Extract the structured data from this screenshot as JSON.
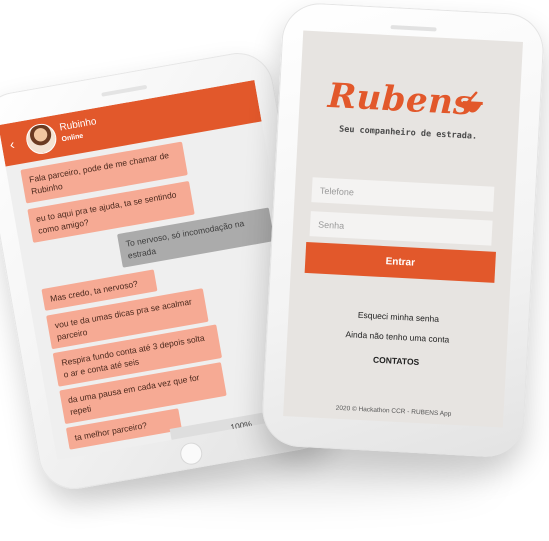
{
  "chat": {
    "contact_name": "Rubinho",
    "status": "Online",
    "back_icon": "back-arrow-icon",
    "messages": [
      {
        "from": "bot",
        "text": "Fala parceiro, pode de me chamar de Rubinho"
      },
      {
        "from": "bot",
        "text": "eu to aqui pra te ajuda, ta se sentindo como amigo?"
      },
      {
        "from": "user",
        "text": "To nervoso, só incomodação na estrada"
      },
      {
        "from": "bot",
        "text": "Mas credo, ta nervoso?"
      },
      {
        "from": "bot",
        "text": "vou te da umas dicas pra se acalmar parceiro"
      },
      {
        "from": "bot",
        "text": "Respira fundo conta até 3 depois solta o ar e conta até seis"
      },
      {
        "from": "bot",
        "text": "da uma pausa em cada vez que for repeti"
      },
      {
        "from": "bot",
        "text": "ta melhor parceiro?"
      }
    ],
    "progress_label": "100%",
    "progress_value": 1.0
  },
  "login": {
    "brand": "Rubens",
    "slogan": "Seu companheiro de estrada.",
    "phone_placeholder": "Telefone",
    "password_placeholder": "Senha",
    "enter_label": "Entrar",
    "forgot_label": "Esqueci minha senha",
    "no_account_label": "Ainda não tenho uma conta",
    "contacts_label": "CONTATOS",
    "footer": "2020 © Hackathon CCR - RUBENS App"
  },
  "colors": {
    "accent": "#e2582b",
    "bot_bubble": "#f6aa94",
    "user_bubble": "#ababab",
    "login_bg": "#e7e4e1"
  }
}
